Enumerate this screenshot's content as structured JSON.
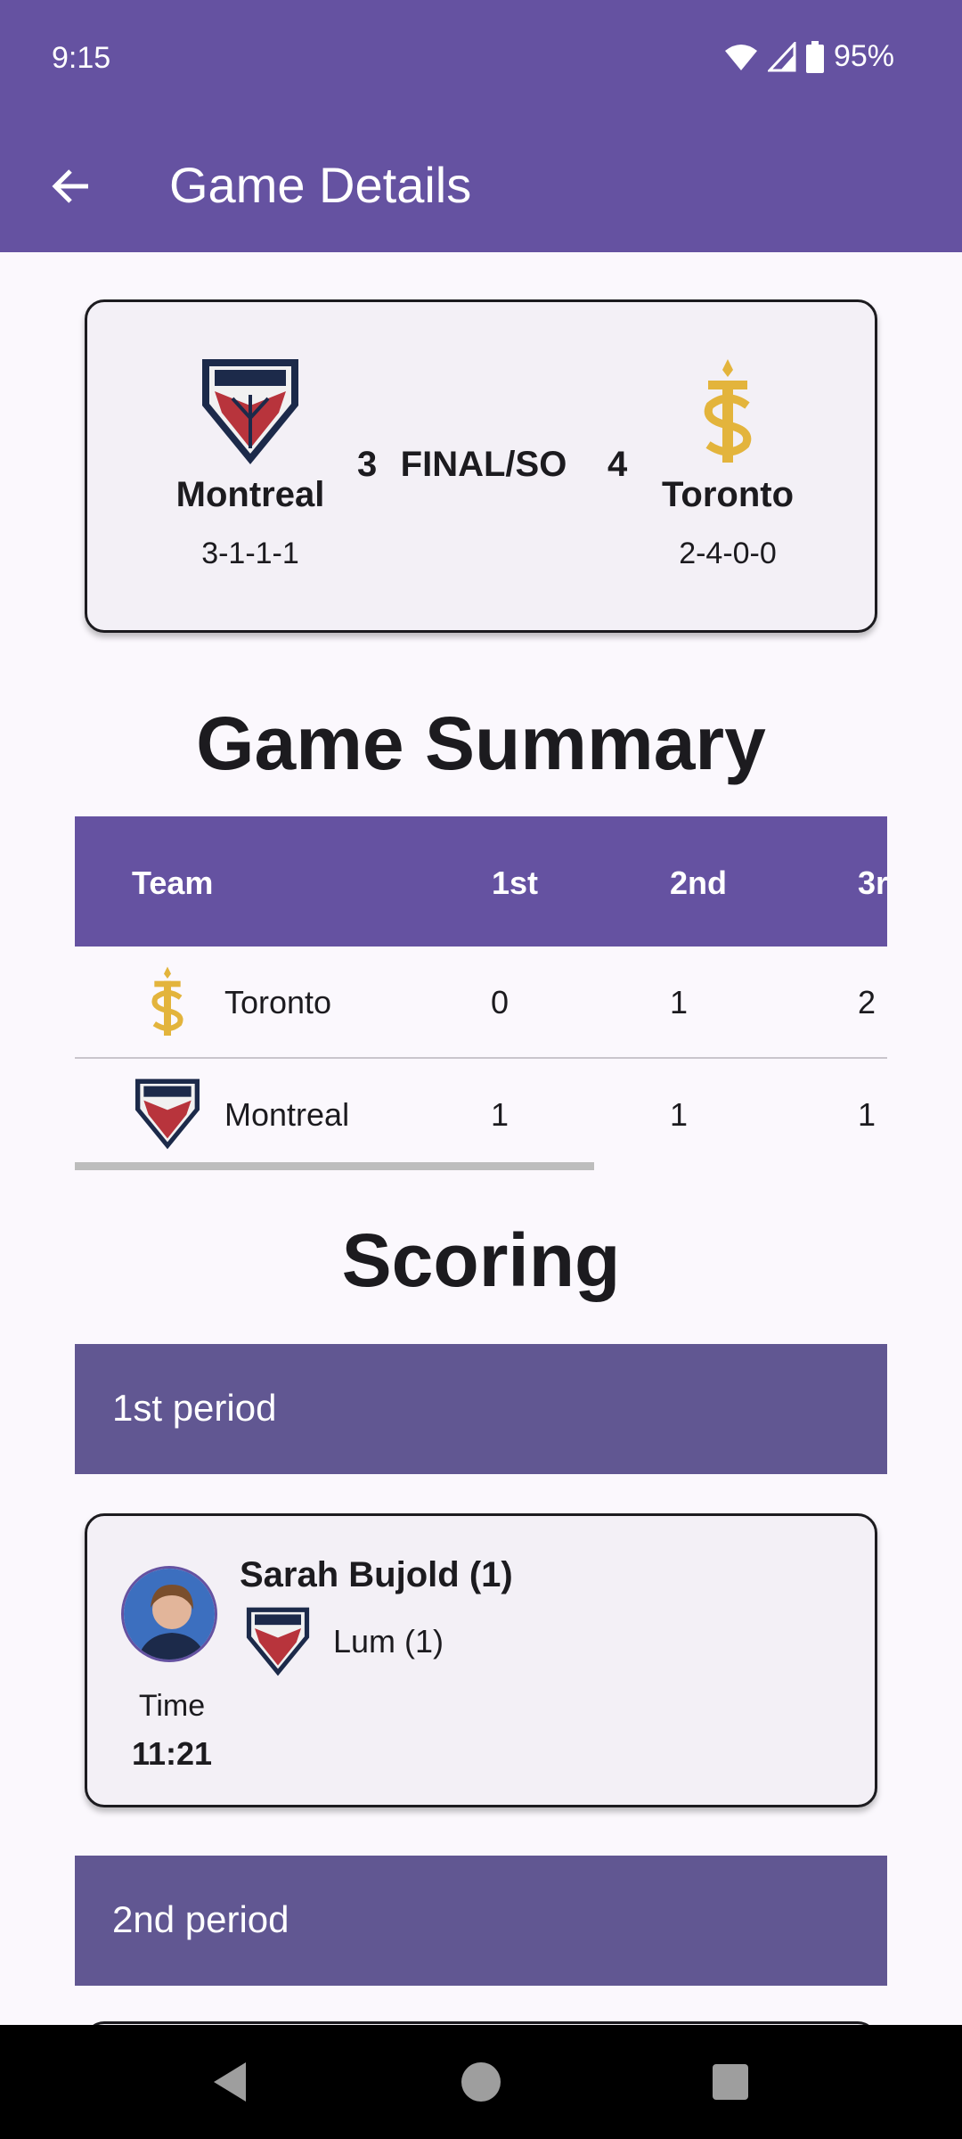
{
  "status_bar": {
    "time": "9:15",
    "battery": "95%"
  },
  "app_bar": {
    "title": "Game Details",
    "back_icon": "arrow-left-icon"
  },
  "game": {
    "home_team": {
      "name": "Montreal",
      "record": "3-1-1-1",
      "score": "3",
      "logo": "montreal-victoire-logo"
    },
    "away_team": {
      "name": "Toronto",
      "record": "2-4-0-0",
      "score": "4",
      "logo": "toronto-sceptres-logo"
    },
    "status": "FINAL/SO"
  },
  "summary": {
    "title": "Game Summary",
    "columns": [
      "Team",
      "1st",
      "2nd",
      "3r"
    ],
    "rows": [
      {
        "team": "Toronto",
        "p1": "0",
        "p2": "1",
        "p3": "2"
      },
      {
        "team": "Montreal",
        "p1": "1",
        "p2": "1",
        "p3": "1"
      }
    ]
  },
  "scoring": {
    "title": "Scoring",
    "periods": [
      {
        "label": "1st period",
        "goals": [
          {
            "scorer": "Sarah Bujold (1)",
            "assist": "Lum (1)",
            "time_label": "Time",
            "time": "11:21"
          }
        ]
      },
      {
        "label": "2nd period"
      }
    ]
  },
  "colors": {
    "primary": "#6552a1",
    "period_header": "#615792",
    "card_bg": "#f3f0f6",
    "background": "#fbf8fd"
  }
}
